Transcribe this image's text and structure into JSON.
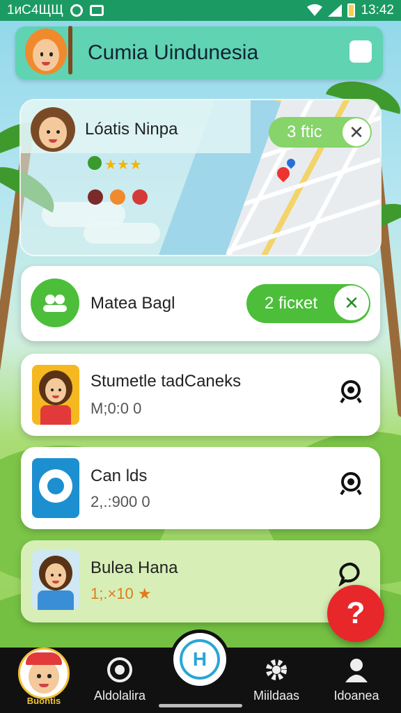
{
  "status_bar": {
    "left_text": "1иC4ЩЩ",
    "time": "13:42"
  },
  "header": {
    "title": "Cumia Uindunesia"
  },
  "map_card": {
    "title": "Lóatis Ninpa",
    "ticket_pill": "3 ftic",
    "stars": "★★★"
  },
  "cards": [
    {
      "title": "Matea Bagl",
      "ticket_pill": "2 ficĸet"
    },
    {
      "title": "Stumetle tadCaneks",
      "subtitle": "M;0:0 0"
    },
    {
      "title": "Can lds",
      "subtitle": "2,.:900 0"
    },
    {
      "title": "Bulea Hana",
      "subtitle": "1;.×10 ★"
    }
  ],
  "fab": {
    "label": "?"
  },
  "bottom_nav": {
    "items": [
      {
        "label": "Buontis"
      },
      {
        "label": "Aldolalira"
      },
      {
        "label": "Miildaas"
      },
      {
        "label": "Idoanea"
      }
    ],
    "center_label": "H"
  },
  "colors": {
    "accent_green": "#4cbe3a",
    "header_teal": "#5fd3b2",
    "status_green": "#1c9a63",
    "fab_red": "#e8272a"
  }
}
